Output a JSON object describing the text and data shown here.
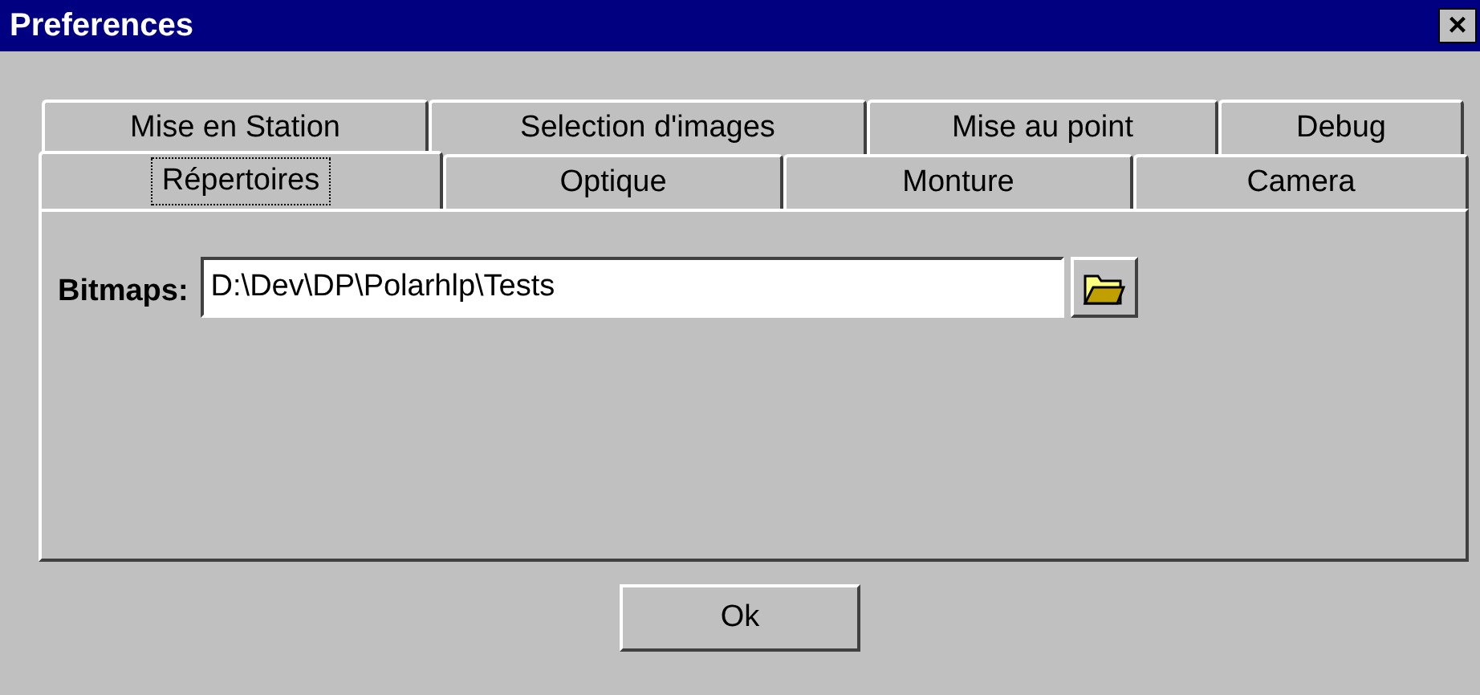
{
  "window": {
    "title": "Preferences",
    "close": "×"
  },
  "tab_rows": [
    [
      {
        "label": "Mise en Station",
        "selected": false
      },
      {
        "label": "Selection d'images",
        "selected": false
      },
      {
        "label": "Mise au point",
        "selected": false
      },
      {
        "label": "Debug",
        "selected": false
      }
    ],
    [
      {
        "label": "Répertoires",
        "selected": true
      },
      {
        "label": "Optique",
        "selected": false
      },
      {
        "label": "Monture",
        "selected": false
      },
      {
        "label": "Camera",
        "selected": false
      }
    ]
  ],
  "field": {
    "label": "Bitmaps:",
    "value": "D:\\Dev\\DP\\Polarhlp\\Tests"
  },
  "buttons": [
    "Ok"
  ]
}
